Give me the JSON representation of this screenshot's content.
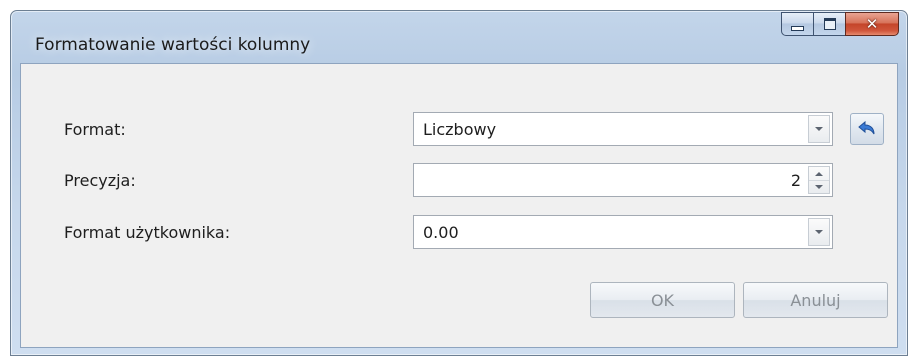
{
  "window": {
    "title": "Formatowanie wartości kolumny",
    "buttons": {
      "minimize": "minimize-icon",
      "maximize": "maximize-icon",
      "close": "close-icon"
    }
  },
  "form": {
    "format": {
      "label": "Format:",
      "value": "Liczbowy"
    },
    "precision": {
      "label": "Precyzja:",
      "value": "2"
    },
    "user_format": {
      "label": "Format użytkownika:",
      "value": "0.00"
    },
    "reset_icon": "undo-arrow-icon"
  },
  "actions": {
    "ok_label": "OK",
    "cancel_label": "Anuluj",
    "ok_enabled": false,
    "cancel_enabled": false
  },
  "colors": {
    "frame": "#b9cde5",
    "client": "#f0f0f0",
    "accent": "#3a7bd5",
    "close": "#c7472d"
  }
}
